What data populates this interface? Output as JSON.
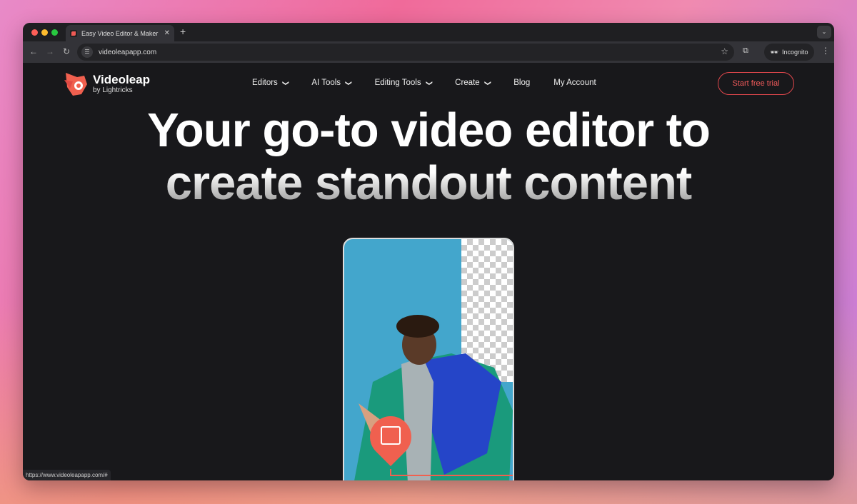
{
  "browser": {
    "tab_title": "Easy Video Editor & Maker | Videoleap",
    "url": "videoleapapp.com",
    "profile": "Incognito",
    "status_url": "https://www.videoleapapp.com/#"
  },
  "site": {
    "logo": {
      "name": "Videoleap",
      "sub": "by Lightricks"
    },
    "nav": [
      {
        "label": "Editors",
        "dropdown": true
      },
      {
        "label": "AI Tools",
        "dropdown": true
      },
      {
        "label": "Editing Tools",
        "dropdown": true
      },
      {
        "label": "Create",
        "dropdown": true
      },
      {
        "label": "Blog",
        "dropdown": false
      },
      {
        "label": "My Account",
        "dropdown": false
      }
    ],
    "cta": "Start free trial",
    "hero": {
      "line1": "Your go-to video editor to",
      "line2": "create standout content"
    },
    "colors": {
      "accent": "#f0604f",
      "background": "#18181b"
    }
  }
}
